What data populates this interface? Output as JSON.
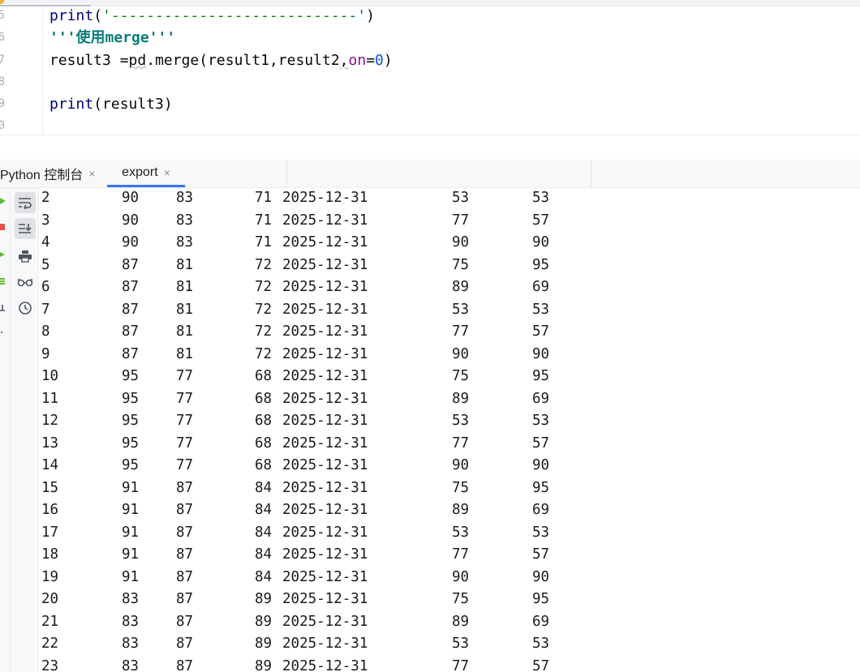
{
  "editor": {
    "lines": [
      {
        "no": "5",
        "segments": [
          {
            "text": "print",
            "cls": "kw-print"
          },
          {
            "text": "(",
            "cls": ""
          },
          {
            "text": "'----------------------------'",
            "cls": "str"
          },
          {
            "text": ")",
            "cls": ""
          }
        ]
      },
      {
        "no": "6",
        "segments": [
          {
            "text": "'''使用merge'''",
            "cls": "doc"
          }
        ]
      },
      {
        "no": "7",
        "segments": [
          {
            "text": "result3 =",
            "cls": ""
          },
          {
            "text": "pd",
            "cls": "squig"
          },
          {
            "text": ".merge(result1",
            "cls": ""
          },
          {
            "text": ",",
            "cls": ""
          },
          {
            "text": "result2",
            "cls": ""
          },
          {
            "text": ",",
            "cls": "squig"
          },
          {
            "text": "on",
            "cls": "named"
          },
          {
            "text": "=",
            "cls": ""
          },
          {
            "text": "0",
            "cls": "num"
          },
          {
            "text": ")",
            "cls": ""
          }
        ]
      },
      {
        "no": "8",
        "segments": []
      },
      {
        "no": "9",
        "segments": [
          {
            "text": "print",
            "cls": "kw-print"
          },
          {
            "text": "(result3)",
            "cls": ""
          }
        ]
      },
      {
        "no": "0",
        "segments": []
      }
    ]
  },
  "tool_window": {
    "tabs": [
      {
        "label": "Python 控制台",
        "close": "×",
        "active": false
      },
      {
        "label": "export",
        "close": "×",
        "active": true
      }
    ]
  },
  "toolbar_icons": [
    "soft-wrap-icon",
    "scroll-to-end-icon",
    "print-icon",
    "glasses-view-icon",
    "history-clock-icon"
  ],
  "left_strip_icons": [
    "run-icon",
    "stop-icon",
    "rerun-icon",
    "variables-icon",
    "settings-icon",
    "more-icon"
  ],
  "console": {
    "rows": [
      [
        "2",
        "90",
        "83",
        "71",
        "2025-12-31",
        "53",
        "53"
      ],
      [
        "3",
        "90",
        "83",
        "71",
        "2025-12-31",
        "77",
        "57"
      ],
      [
        "4",
        "90",
        "83",
        "71",
        "2025-12-31",
        "90",
        "90"
      ],
      [
        "5",
        "87",
        "81",
        "72",
        "2025-12-31",
        "75",
        "95"
      ],
      [
        "6",
        "87",
        "81",
        "72",
        "2025-12-31",
        "89",
        "69"
      ],
      [
        "7",
        "87",
        "81",
        "72",
        "2025-12-31",
        "53",
        "53"
      ],
      [
        "8",
        "87",
        "81",
        "72",
        "2025-12-31",
        "77",
        "57"
      ],
      [
        "9",
        "87",
        "81",
        "72",
        "2025-12-31",
        "90",
        "90"
      ],
      [
        "10",
        "95",
        "77",
        "68",
        "2025-12-31",
        "75",
        "95"
      ],
      [
        "11",
        "95",
        "77",
        "68",
        "2025-12-31",
        "89",
        "69"
      ],
      [
        "12",
        "95",
        "77",
        "68",
        "2025-12-31",
        "53",
        "53"
      ],
      [
        "13",
        "95",
        "77",
        "68",
        "2025-12-31",
        "77",
        "57"
      ],
      [
        "14",
        "95",
        "77",
        "68",
        "2025-12-31",
        "90",
        "90"
      ],
      [
        "15",
        "91",
        "87",
        "84",
        "2025-12-31",
        "75",
        "95"
      ],
      [
        "16",
        "91",
        "87",
        "84",
        "2025-12-31",
        "89",
        "69"
      ],
      [
        "17",
        "91",
        "87",
        "84",
        "2025-12-31",
        "53",
        "53"
      ],
      [
        "18",
        "91",
        "87",
        "84",
        "2025-12-31",
        "77",
        "57"
      ],
      [
        "19",
        "91",
        "87",
        "84",
        "2025-12-31",
        "90",
        "90"
      ],
      [
        "20",
        "83",
        "87",
        "89",
        "2025-12-31",
        "75",
        "95"
      ],
      [
        "21",
        "83",
        "87",
        "89",
        "2025-12-31",
        "89",
        "69"
      ],
      [
        "22",
        "83",
        "87",
        "89",
        "2025-12-31",
        "53",
        "53"
      ],
      [
        "23",
        "83",
        "87",
        "89",
        "2025-12-31",
        "77",
        "57"
      ]
    ]
  },
  "colors": {
    "accent": "#3574f0",
    "run_green": "#5fb832",
    "stop_red": "#e5534b"
  }
}
